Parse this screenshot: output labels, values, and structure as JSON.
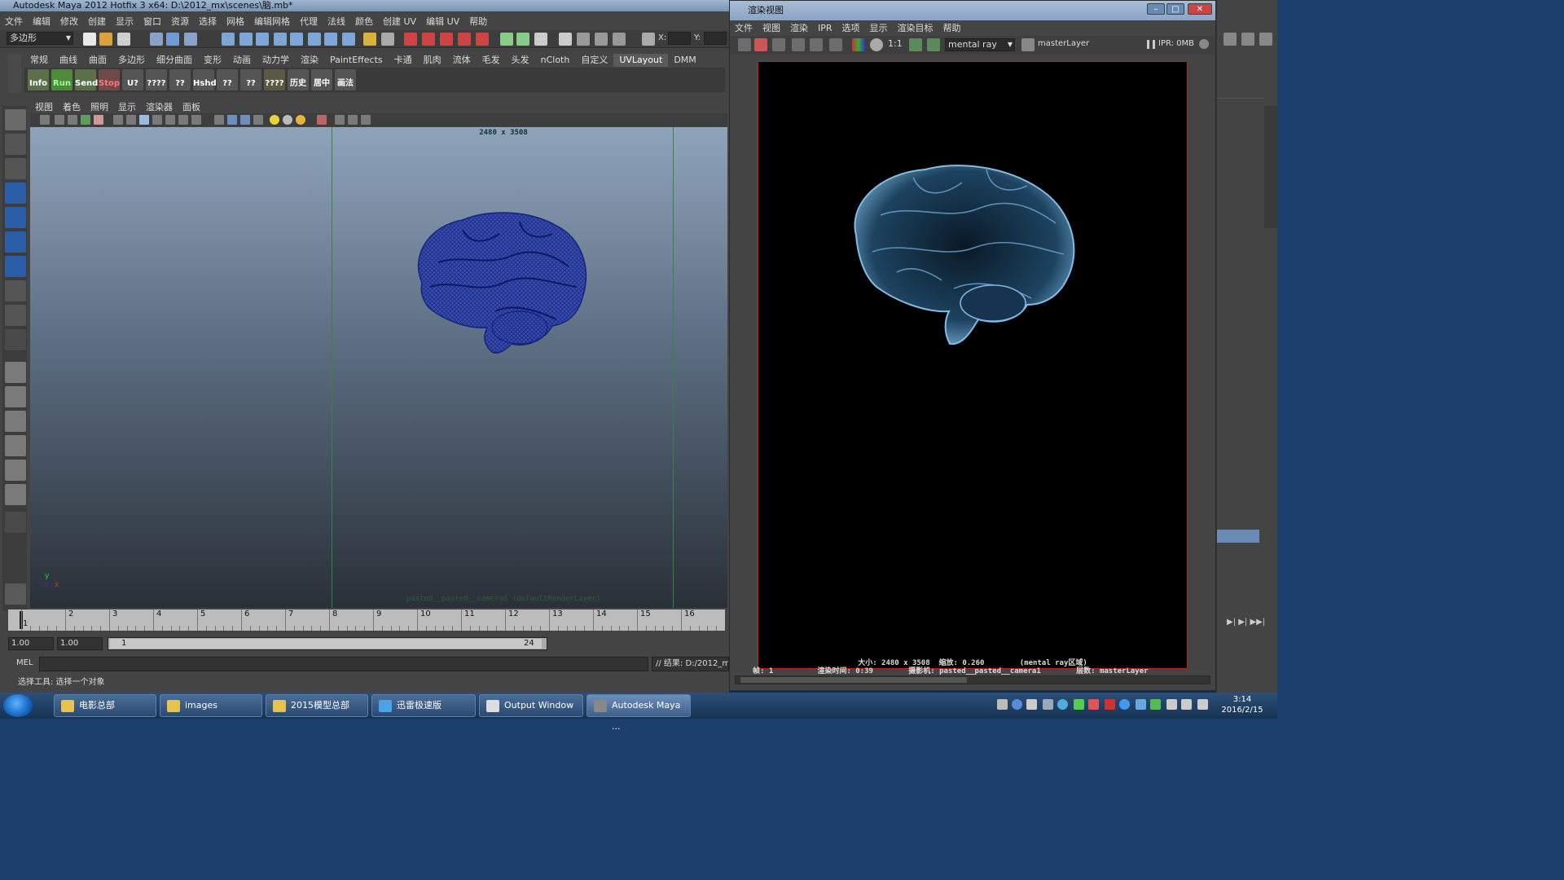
{
  "maya": {
    "title": "Autodesk Maya 2012 Hotfix 3 x64: D:\\2012_mx\\scenes\\脑.mb*",
    "menu": [
      "文件",
      "编辑",
      "修改",
      "创建",
      "显示",
      "窗口",
      "资源",
      "选择",
      "网格",
      "编辑网格",
      "代理",
      "法线",
      "颜色",
      "创建 UV",
      "编辑 UV",
      "帮助"
    ],
    "mode_select": "多边形",
    "status_x_label": "X:",
    "status_y_label": "Y:",
    "shelf_tabs": [
      "常规",
      "曲线",
      "曲面",
      "多边形",
      "细分曲面",
      "变形",
      "动画",
      "动力学",
      "渲染",
      "PaintEffects",
      "卡通",
      "肌肉",
      "流体",
      "毛发",
      "头发",
      "nCloth",
      "自定义",
      "UVLayout",
      "DMM"
    ],
    "shelf_active_tab": "UVLayout",
    "shelf_buttons": [
      "Info",
      "Run",
      "Send",
      "Stop",
      "U?",
      "????",
      "??",
      "Hshd",
      "??",
      "??",
      "????",
      "历史",
      "居中",
      "画法"
    ],
    "panel_menu": [
      "视图",
      "着色",
      "照明",
      "显示",
      "渲染器",
      "面板"
    ],
    "viewport": {
      "resolution_gate": "2480 x 3508",
      "camera_label": "pasted__pasted__camera1 (defaultRenderLayer)",
      "axis_y": "y",
      "axis_x": "x",
      "axis_z": "z"
    },
    "timeslider_numbers": [
      "1",
      "2",
      "3",
      "4",
      "5",
      "6",
      "7",
      "8",
      "9",
      "10",
      "11",
      "12",
      "13",
      "14",
      "15",
      "16"
    ],
    "current_frame": "1",
    "range": {
      "start_time": "1.00",
      "playback_start": "1.00",
      "range_start": "1",
      "range_end": "24"
    },
    "mel_label": "MEL",
    "result_text": "// 结果: D:/2012_m",
    "help_line": "选择工具: 选择一个对象"
  },
  "render_view": {
    "title": "渲染视图",
    "menu": [
      "文件",
      "视图",
      "渲染",
      "IPR",
      "选项",
      "显示",
      "渲染目标",
      "帮助"
    ],
    "ratio_label": "1:1",
    "renderer": "mental ray",
    "layer": "masterLayer",
    "ipr_memory": "IPR: 0MB",
    "info_line1": "大小: 2480 x 3508  缩放: 0.260        (mental ray区域)",
    "info_line2": "帧: 1          渲染时间: 0:39        摄影机: pasted__pasted__camera1        层数: masterLayer"
  },
  "taskbar": {
    "items": [
      {
        "label": "电影总部",
        "icon": "folder-icon"
      },
      {
        "label": "images",
        "icon": "folder-icon"
      },
      {
        "label": "2015模型总部",
        "icon": "folder-icon"
      },
      {
        "label": "迅雷极速版",
        "icon": "thunder-icon"
      },
      {
        "label": "Output Window",
        "icon": "console-icon"
      },
      {
        "label": "Autodesk Maya ...",
        "icon": "maya-icon"
      }
    ],
    "clock_time": "3:14",
    "clock_date": "2016/2/15"
  },
  "colors": {
    "wireframe": "#1a2a8c",
    "render_brain": "#5f9cc8",
    "render_border": "#c01e1e",
    "camera_gate": "#2d8a3a"
  }
}
